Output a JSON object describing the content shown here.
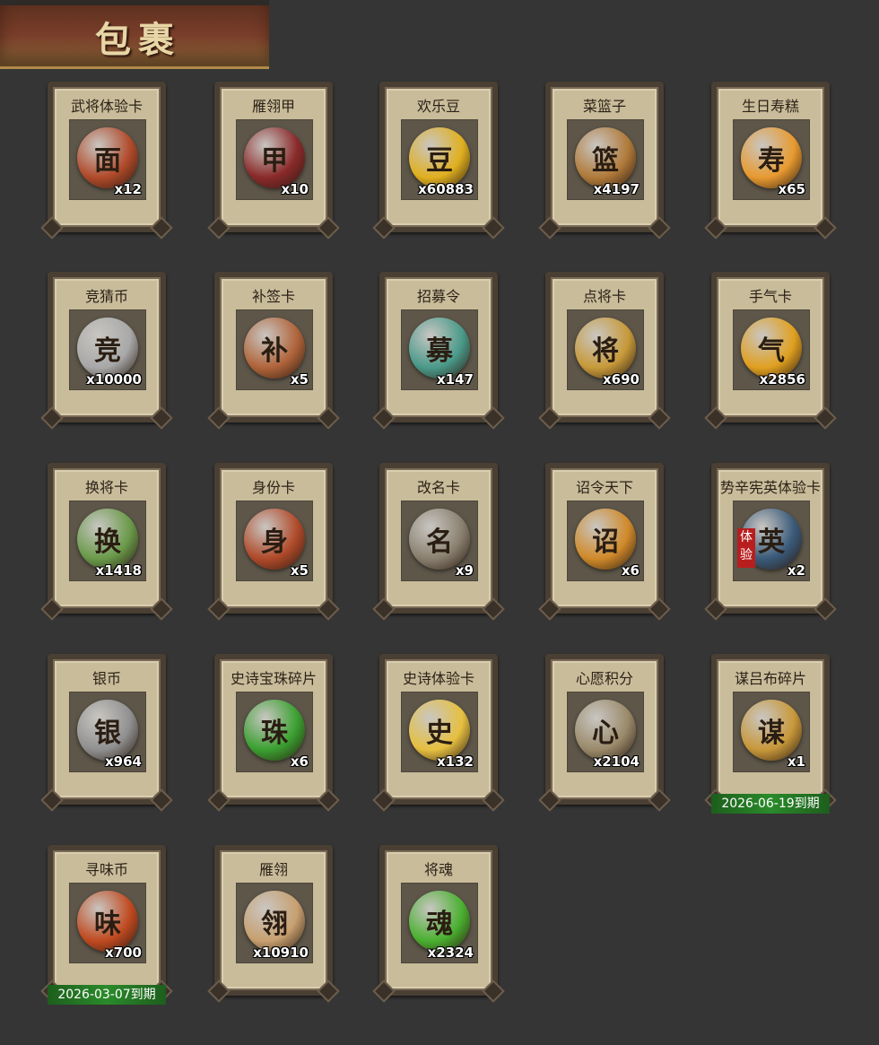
{
  "header": {
    "title": "包裹"
  },
  "items": [
    {
      "name": "武将体验卡",
      "count": "x12",
      "icon": "opera-mask-card-icon",
      "color": "#b04a2a",
      "glyph": "面"
    },
    {
      "name": "雁翎甲",
      "count": "x10",
      "icon": "armor-icon",
      "color": "#8a2a2a",
      "glyph": "甲"
    },
    {
      "name": "欢乐豆",
      "count": "x60883",
      "icon": "gold-beans-icon",
      "color": "#e0b020",
      "glyph": "豆"
    },
    {
      "name": "菜篮子",
      "count": "x4197",
      "icon": "basket-icon",
      "color": "#b07a3a",
      "glyph": "篮"
    },
    {
      "name": "生日寿糕",
      "count": "x65",
      "icon": "birthday-cake-icon",
      "color": "#e89a30",
      "glyph": "寿"
    },
    {
      "name": "竞猜币",
      "count": "x10000",
      "icon": "silver-coin-icon",
      "color": "#a8a8a8",
      "glyph": "竞"
    },
    {
      "name": "补签卡",
      "count": "x5",
      "icon": "token-card-icon",
      "color": "#b0643a",
      "glyph": "补"
    },
    {
      "name": "招募令",
      "count": "x147",
      "icon": "recruit-token-icon",
      "color": "#4a9a8a",
      "glyph": "募"
    },
    {
      "name": "点将卡",
      "count": "x690",
      "icon": "general-token-icon",
      "color": "#c79a3a",
      "glyph": "将"
    },
    {
      "name": "手气卡",
      "count": "x2856",
      "icon": "luck-card-icon",
      "color": "#e0a020",
      "glyph": "气"
    },
    {
      "name": "换将卡",
      "count": "x1418",
      "icon": "swap-token-icon",
      "color": "#6a9a4a",
      "glyph": "换"
    },
    {
      "name": "身份卡",
      "count": "x5",
      "icon": "identity-mask-card-icon",
      "color": "#b04a2a",
      "glyph": "身"
    },
    {
      "name": "改名卡",
      "count": "x9",
      "icon": "rename-token-icon",
      "color": "#8a8070",
      "glyph": "名"
    },
    {
      "name": "诏令天下",
      "count": "x6",
      "icon": "edict-scroll-icon",
      "color": "#d08a2a",
      "glyph": "诏"
    },
    {
      "name": "势辛宪英体验卡",
      "count": "x2",
      "icon": "hero-portrait-icon",
      "color": "#3a5a7a",
      "glyph": "英",
      "trial": "体验"
    },
    {
      "name": "银币",
      "count": "x964",
      "icon": "silver-coins-icon",
      "color": "#909090",
      "glyph": "银"
    },
    {
      "name": "史诗宝珠碎片",
      "count": "x6",
      "icon": "green-shard-icon",
      "color": "#3aa030",
      "glyph": "珠"
    },
    {
      "name": "史诗体验卡",
      "count": "x132",
      "icon": "gold-card-icon",
      "color": "#e6c040",
      "glyph": "史"
    },
    {
      "name": "心愿积分",
      "count": "x2104",
      "icon": "heart-coin-icon",
      "color": "#9a8a6a",
      "glyph": "心"
    },
    {
      "name": "谋吕布碎片",
      "count": "x1",
      "icon": "puzzle-piece-icon",
      "color": "#c8983a",
      "glyph": "谋",
      "expiry": "2026-06-19到期"
    },
    {
      "name": "寻味币",
      "count": "x700",
      "icon": "taste-coin-icon",
      "color": "#c04a20",
      "glyph": "味",
      "expiry": "2026-03-07到期"
    },
    {
      "name": "雁翎",
      "count": "x10910",
      "icon": "feather-icon",
      "color": "#c8a070",
      "glyph": "翎"
    },
    {
      "name": "将魂",
      "count": "x2324",
      "icon": "green-crystal-icon",
      "color": "#4ab030",
      "glyph": "魂"
    }
  ]
}
